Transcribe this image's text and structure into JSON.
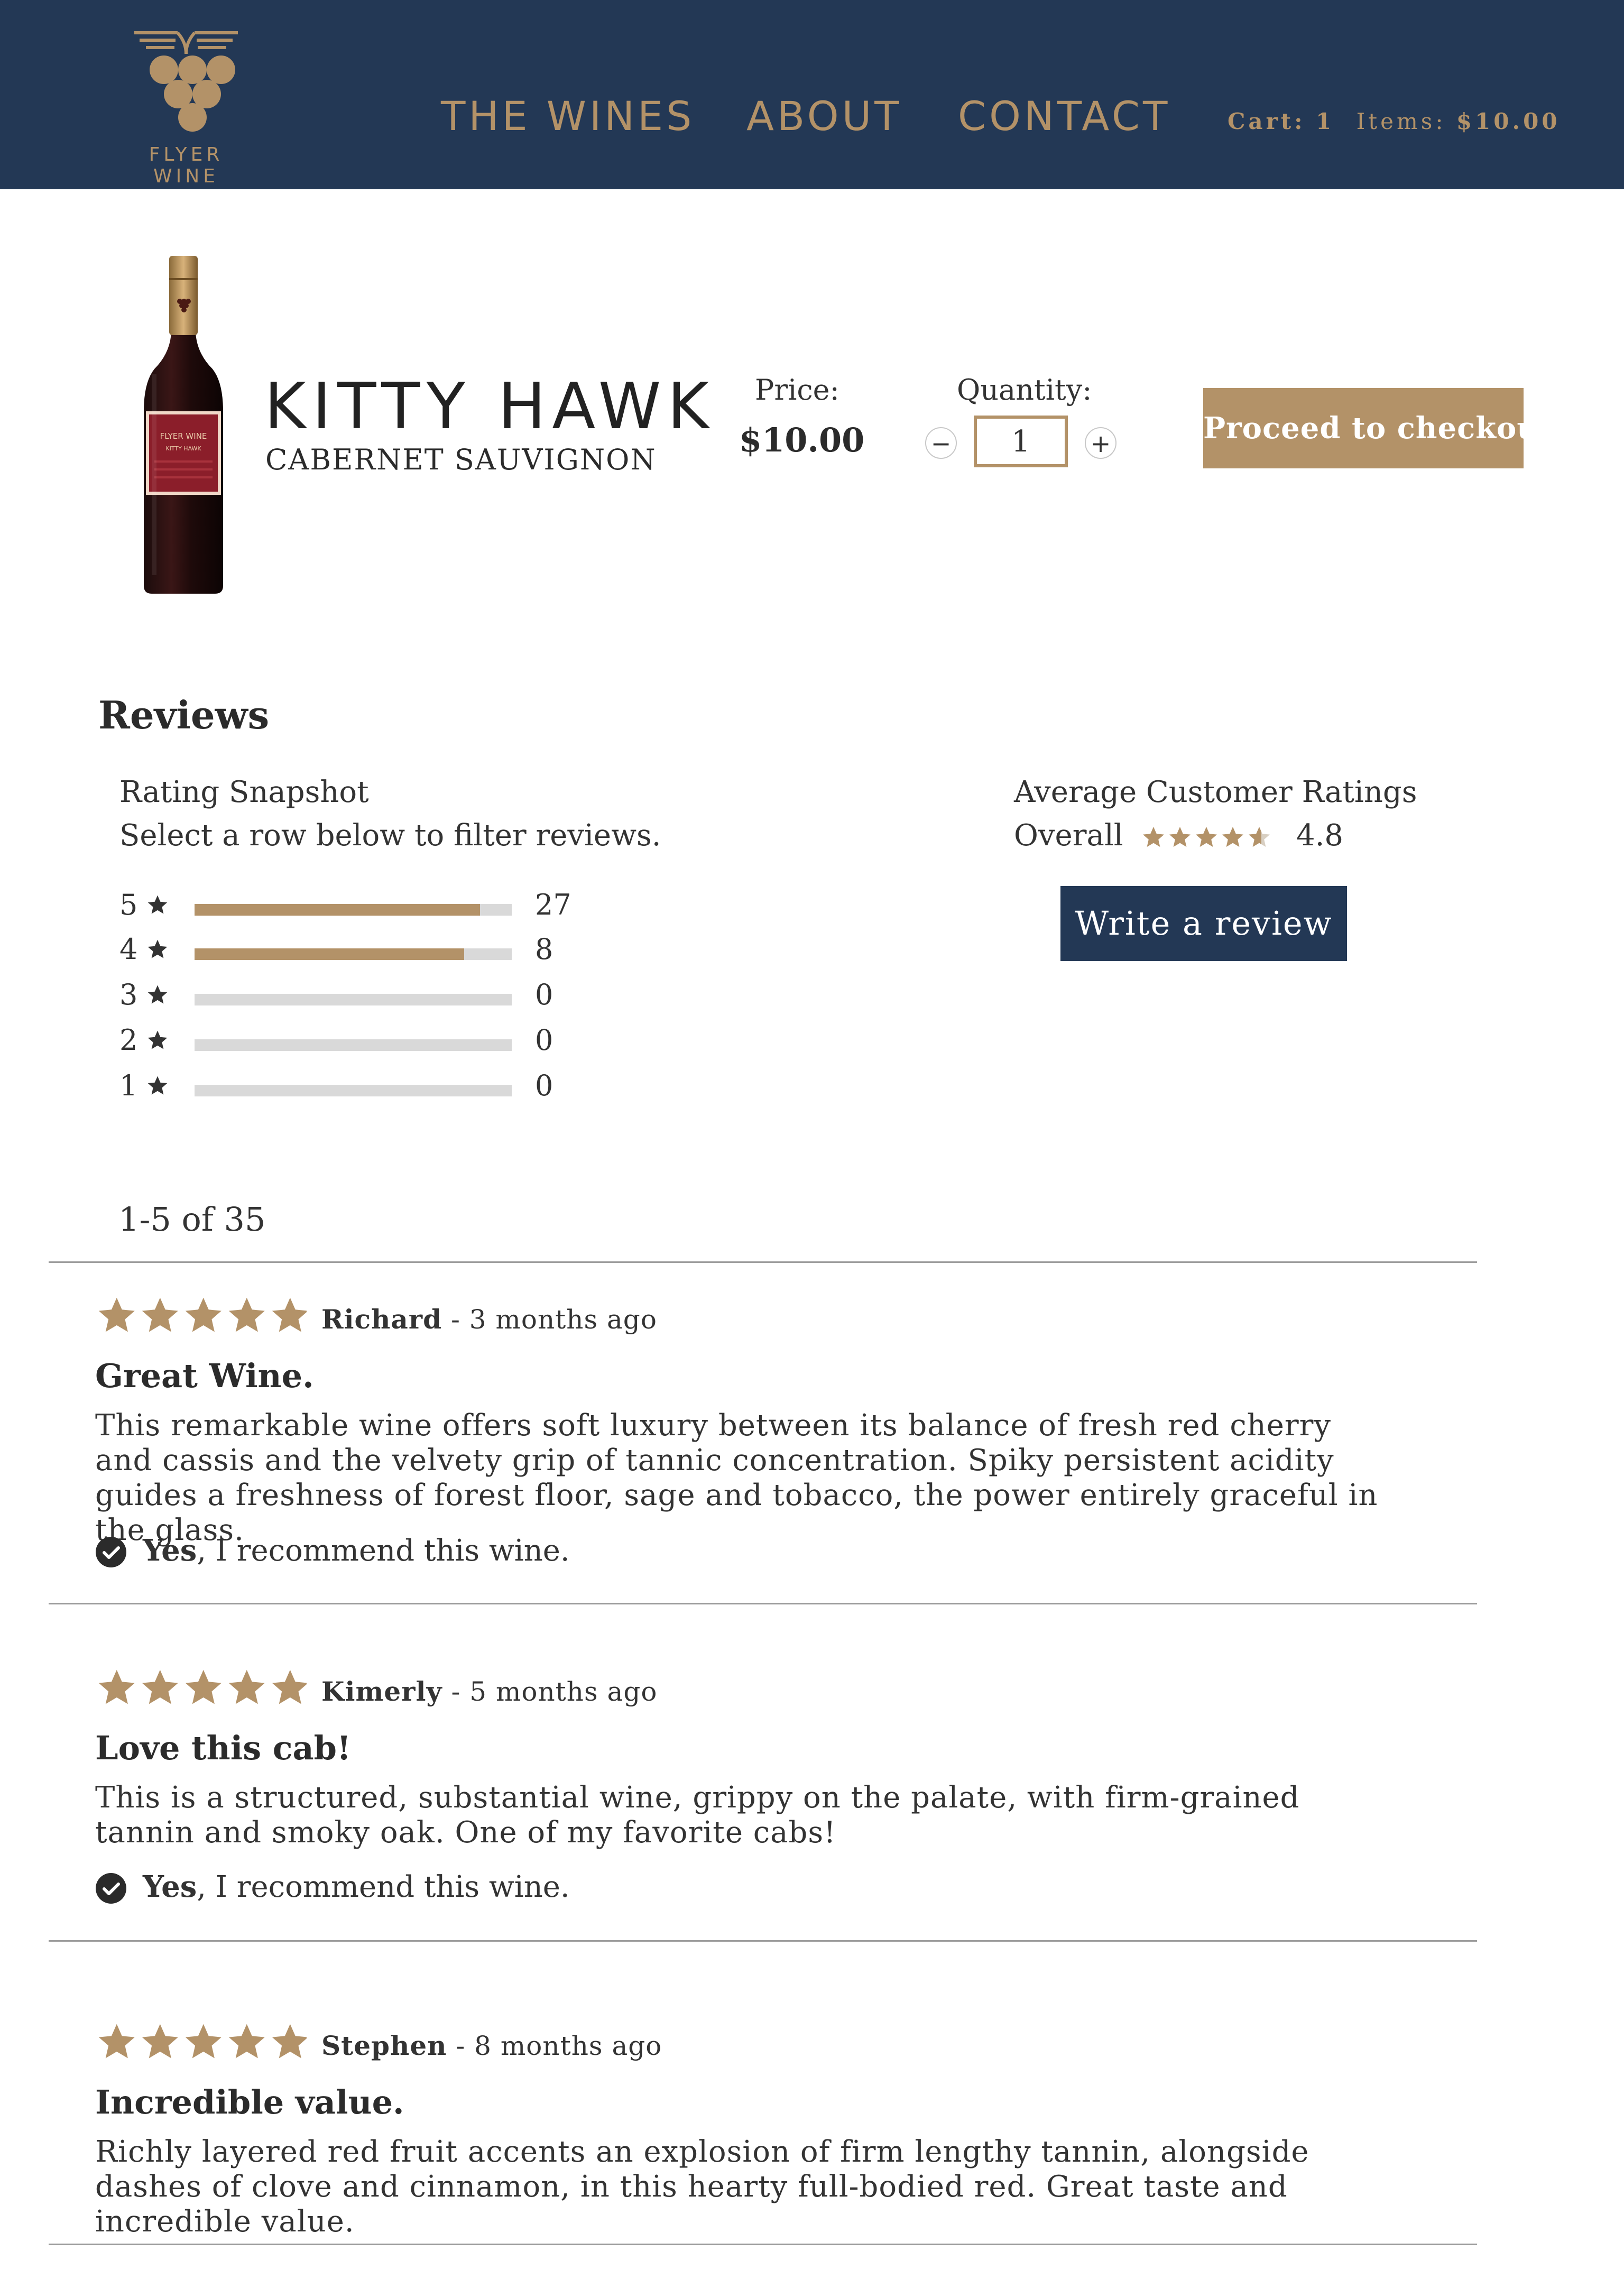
{
  "header": {
    "logo_text": "FLYER WINE",
    "nav": [
      "THE WINES",
      "ABOUT",
      "CONTACT"
    ],
    "cart_label": "Cart:",
    "cart_count": "1",
    "items_label": "Items:",
    "cart_total": "$10.00"
  },
  "colors": {
    "brand_navy": "#233855",
    "brand_gold": "#b39268",
    "bar_empty": "#d9d9d9"
  },
  "product": {
    "name": "KITTY HAWK",
    "varietal": "CABERNET SAUVIGNON",
    "price_label": "Price:",
    "price": "$10.00",
    "quantity_label": "Quantity:",
    "quantity": "1",
    "checkout_label": "Proceed to checkout",
    "bottle_label_line1": "FLYER WINE",
    "bottle_label_line2": "KITTY HAWK"
  },
  "reviews_summary": {
    "title": "Reviews",
    "snapshot_title": "Rating Snapshot",
    "snapshot_subtitle": "Select a row below to filter reviews.",
    "rows": [
      {
        "stars": "5",
        "count": "27",
        "fill": 0.9
      },
      {
        "stars": "4",
        "count": "8",
        "fill": 0.85
      },
      {
        "stars": "3",
        "count": "0",
        "fill": 0
      },
      {
        "stars": "2",
        "count": "0",
        "fill": 0
      },
      {
        "stars": "1",
        "count": "0",
        "fill": 0
      }
    ],
    "average_title": "Average Customer Ratings",
    "overall_label": "Overall",
    "overall_value": "4.8",
    "overall_stars": 4.8,
    "write_review_label": "Write a review"
  },
  "pagination": {
    "text": "1-5 of 35"
  },
  "reviews": [
    {
      "rating": 5,
      "author": "Richard",
      "time": " - 3 months ago",
      "title": "Great Wine.",
      "body": "This remarkable wine offers soft luxury between its balance of fresh red cherry and cassis and the velvety grip of tannic concentration. Spiky persistent acidity guides a freshness of forest floor, sage and tobacco, the power entirely graceful in the glass.",
      "recommend_yes": "Yes",
      "recommend_text": ", I recommend this wine."
    },
    {
      "rating": 5,
      "author": "Kimerly",
      "time": " - 5 months ago",
      "title": "Love this cab!",
      "body": "This is a structured, substantial wine, grippy on the palate, with firm-grained tannin and smoky oak. One of my favorite cabs!",
      "recommend_yes": "Yes",
      "recommend_text": ", I recommend this wine."
    },
    {
      "rating": 5,
      "author": "Stephen",
      "time": " - 8 months ago",
      "title": "Incredible value.",
      "body": "Richly layered red fruit accents an explosion of firm lengthy tannin, alongside dashes of clove and cinnamon, in this hearty full-bodied red. Great taste and incredible value."
    }
  ]
}
